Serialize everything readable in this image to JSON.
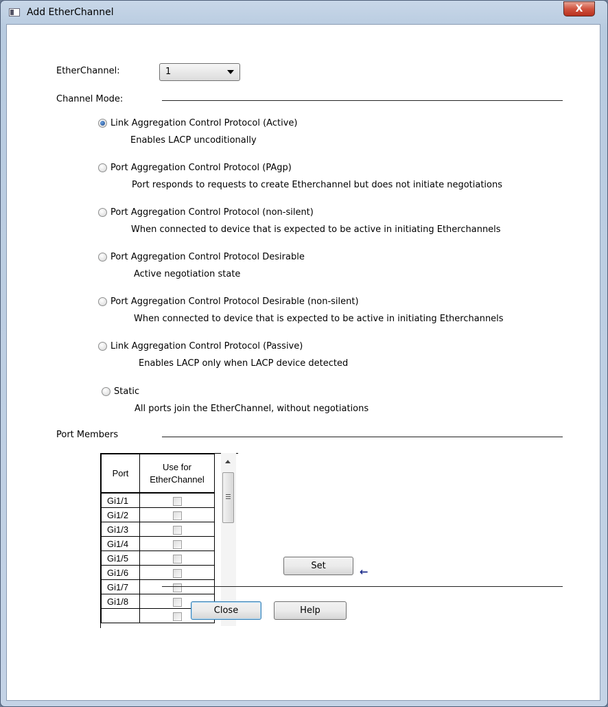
{
  "window": {
    "title": "Add EtherChannel",
    "close_label": "X"
  },
  "etherchannel": {
    "label": "EtherChannel:",
    "value": "1"
  },
  "channel_mode": {
    "label": "Channel Mode:",
    "options": [
      {
        "label": "Link Aggregation Control Protocol (Active)",
        "desc": "Enables LACP uncoditionally",
        "checked": true
      },
      {
        "label": "Port Aggregation Control Protocol (PAgp)",
        "desc": "Port responds to requests to create Etherchannel but does not initiate negotiations",
        "checked": false
      },
      {
        "label": "Port Aggregation Control Protocol (non-silent)",
        "desc": "When connected to device that is expected to be active in initiating Etherchannels",
        "checked": false
      },
      {
        "label": "Port Aggregation Control Protocol Desirable",
        "desc": "Active negotiation state",
        "checked": false
      },
      {
        "label": "Port Aggregation Control Protocol Desirable (non-silent)",
        "desc": "When connected to device that is expected to be active in initiating Etherchannels",
        "checked": false
      },
      {
        "label": "Link Aggregation Control Protocol (Passive)",
        "desc": "Enables LACP only when LACP device detected",
        "checked": false
      },
      {
        "label": "Static",
        "desc": "All ports join the EtherChannel, without negotiations",
        "checked": false
      }
    ]
  },
  "port_members": {
    "label": "Port Members",
    "columns": [
      "Port",
      "Use for",
      "EtherChannel"
    ],
    "rows": [
      "Gi1/1",
      "Gi1/2",
      "Gi1/3",
      "Gi1/4",
      "Gi1/5",
      "Gi1/6",
      "Gi1/7",
      "Gi1/8"
    ]
  },
  "buttons": {
    "set": "Set",
    "close": "Close",
    "help": "Help"
  },
  "icons": {
    "title": "app-window-icon",
    "set_pointer": "left-arrow-icon"
  }
}
